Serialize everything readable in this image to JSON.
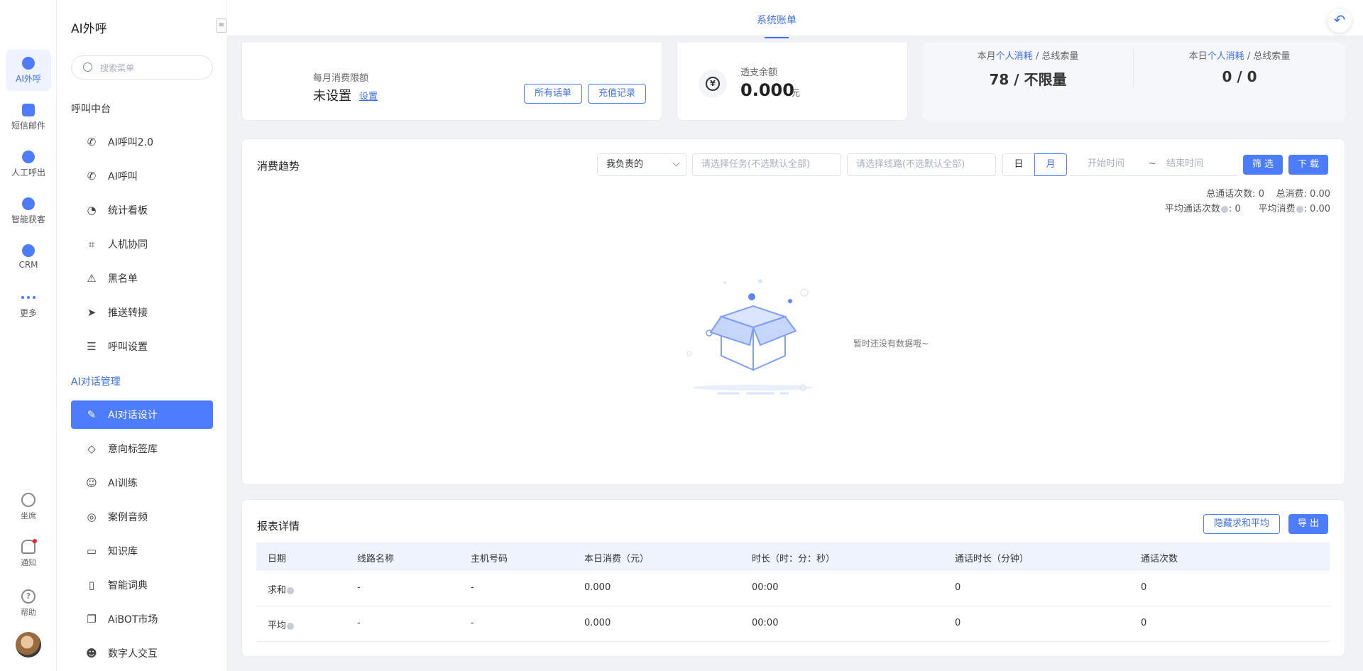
{
  "rail": {
    "items": [
      {
        "label": "AI外呼",
        "icon": "robot-icon"
      },
      {
        "label": "短信邮件",
        "icon": "message-icon"
      },
      {
        "label": "人工呼出",
        "icon": "phone-out-icon"
      },
      {
        "label": "智能获客",
        "icon": "target-icon"
      },
      {
        "label": "CRM",
        "icon": "crm-icon"
      },
      {
        "label": "更多",
        "icon": "more-icon"
      }
    ],
    "bottom": [
      {
        "label": "坐席",
        "icon": "headset-icon"
      },
      {
        "label": "通知",
        "icon": "bell-icon"
      },
      {
        "label": "帮助",
        "icon": "help-icon"
      }
    ]
  },
  "sidebar": {
    "title": "AI外呼",
    "search_placeholder": "搜索菜单",
    "group1": "呼叫中台",
    "group1_items": [
      {
        "label": "AI呼叫2.0",
        "icon": "phone-call-icon",
        "glyph": "✆"
      },
      {
        "label": "AI呼叫",
        "icon": "phone-icon",
        "glyph": "✆"
      },
      {
        "label": "统计看板",
        "icon": "pie-chart-icon",
        "glyph": "◔"
      },
      {
        "label": "人机协同",
        "icon": "scan-face-icon",
        "glyph": "⌗"
      },
      {
        "label": "黑名单",
        "icon": "warning-icon",
        "glyph": "⚠"
      },
      {
        "label": "推送转接",
        "icon": "send-icon",
        "glyph": "➤"
      },
      {
        "label": "呼叫设置",
        "icon": "sliders-icon",
        "glyph": "☰"
      }
    ],
    "group2": "AI对话管理",
    "group2_items": [
      {
        "label": "AI对话设计",
        "icon": "edit-icon",
        "glyph": "✎"
      },
      {
        "label": "意向标签库",
        "icon": "tag-icon",
        "glyph": "◇"
      },
      {
        "label": "AI训练",
        "icon": "chat-bubble-icon",
        "glyph": "☺"
      },
      {
        "label": "案例音频",
        "icon": "voicemail-icon",
        "glyph": "◎"
      },
      {
        "label": "知识库",
        "icon": "laptop-icon",
        "glyph": "▭"
      },
      {
        "label": "智能词典",
        "icon": "book-icon",
        "glyph": "▯"
      },
      {
        "label": "AiBOT市场",
        "icon": "comments-icon",
        "glyph": "❐"
      },
      {
        "label": "数字人交互",
        "icon": "digital-human-icon",
        "glyph": "☻"
      }
    ]
  },
  "topbar": {
    "tab": "系统账单",
    "back_icon": "back-arrow-icon"
  },
  "card1": {
    "label": "每月消费限额",
    "value": "未设置",
    "set_link": "设置",
    "btn_all_bills": "所有话单",
    "btn_recharge": "充值记录"
  },
  "card2": {
    "label": "透支余额",
    "value": "0.000",
    "unit": "元"
  },
  "card3": {
    "month_prefix": "本月",
    "month_highlight": "个人消耗",
    "month_suffix": "/ 总线索量",
    "month_value": "78 / 不限量",
    "day_prefix": "本日",
    "day_highlight": "个人消耗",
    "day_suffix": "/ 总线索量",
    "day_value": "0 / 0"
  },
  "trend": {
    "title": "消费趋势",
    "owner_select": "我负责的",
    "task_placeholder": "请选择任务(不选默认全部)",
    "line_placeholder": "请选择线路(不选默认全部)",
    "seg_day": "日",
    "seg_month": "月",
    "start_placeholder": "开始时间",
    "tilde": "~",
    "end_placeholder": "结束时间",
    "filter_btn": "筛 选",
    "download_btn": "下 载",
    "stats_total_calls_label": "总通话次数:",
    "stats_total_calls": "0",
    "stats_total_cost_label": "总消费:",
    "stats_total_cost": "0.00",
    "stats_avg_calls_label": "平均通话次数",
    "stats_avg_calls": "0",
    "stats_avg_cost_label": "平均消费",
    "stats_avg_cost": "0.00",
    "empty_text": "暂时还没有数据哦~"
  },
  "report": {
    "title": "报表详情",
    "hide_btn": "隐藏求和平均",
    "export_btn": "导 出",
    "columns": [
      "日期",
      "线路名称",
      "主机号码",
      "本日消费（元）",
      "时长（时：分：秒）",
      "通话时长（分钟）",
      "通话次数"
    ],
    "rows": [
      [
        "求和",
        "-",
        "-",
        "0.000",
        "00:00",
        "0",
        "0"
      ],
      [
        "平均",
        "-",
        "-",
        "0.000",
        "00:00",
        "0",
        "0"
      ]
    ]
  }
}
